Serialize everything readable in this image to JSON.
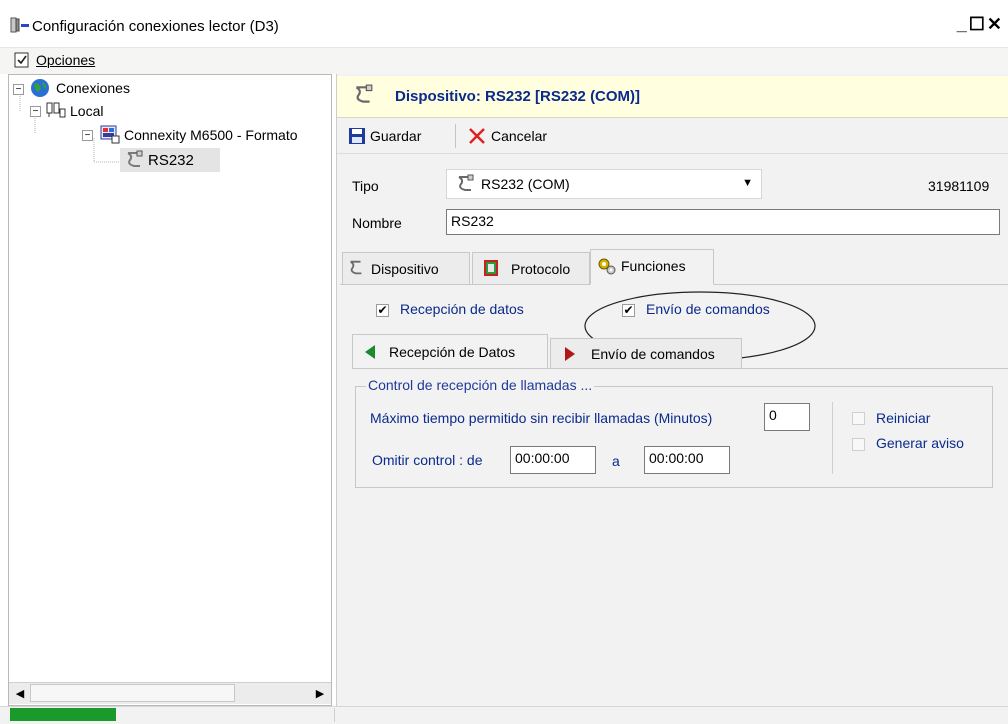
{
  "window": {
    "title": "Configuración conexiones lector (D3)",
    "controls": "_☐✕"
  },
  "menu": {
    "options_label": "Opciones"
  },
  "tree": {
    "root": "Conexiones",
    "local": "Local",
    "device_group": "Connexity M6500 - Formato",
    "device": "RS232"
  },
  "header": {
    "title": "Dispositivo: RS232 [RS232 (COM)]"
  },
  "toolbar": {
    "save_label": "Guardar",
    "cancel_label": "Cancelar"
  },
  "form": {
    "tipo_label": "Tipo",
    "tipo_value": "RS232 (COM)",
    "id_value": "31981109",
    "nombre_label": "Nombre",
    "nombre_value": "RS232"
  },
  "tabs": {
    "dispositivo": "Dispositivo",
    "protocolo": "Protocolo",
    "funciones": "Funciones"
  },
  "functions": {
    "recepcion_label": "Recepción de datos",
    "recepcion_checked": true,
    "envio_label": "Envío de comandos",
    "envio_checked": true
  },
  "subtabs": {
    "recepcion": "Recepción de Datos",
    "envio": "Envío de comandos"
  },
  "control": {
    "group_title": "Control de recepción de llamadas ...",
    "max_time_label": "Máximo tiempo permitido sin recibir llamadas (Minutos)",
    "max_time_value": "0",
    "omit_label": "Omitir control : de",
    "from_value": "00:00:00",
    "to_label": "a",
    "to_value": "00:00:00",
    "reiniciar_label": "Reiniciar",
    "generar_label": "Generar aviso"
  },
  "colors": {
    "accent_blue": "#0a2a8c",
    "group_title_blue": "#1f3a9a",
    "progress_green": "#1a9a2a",
    "header_yellow": "#ffffe0"
  }
}
